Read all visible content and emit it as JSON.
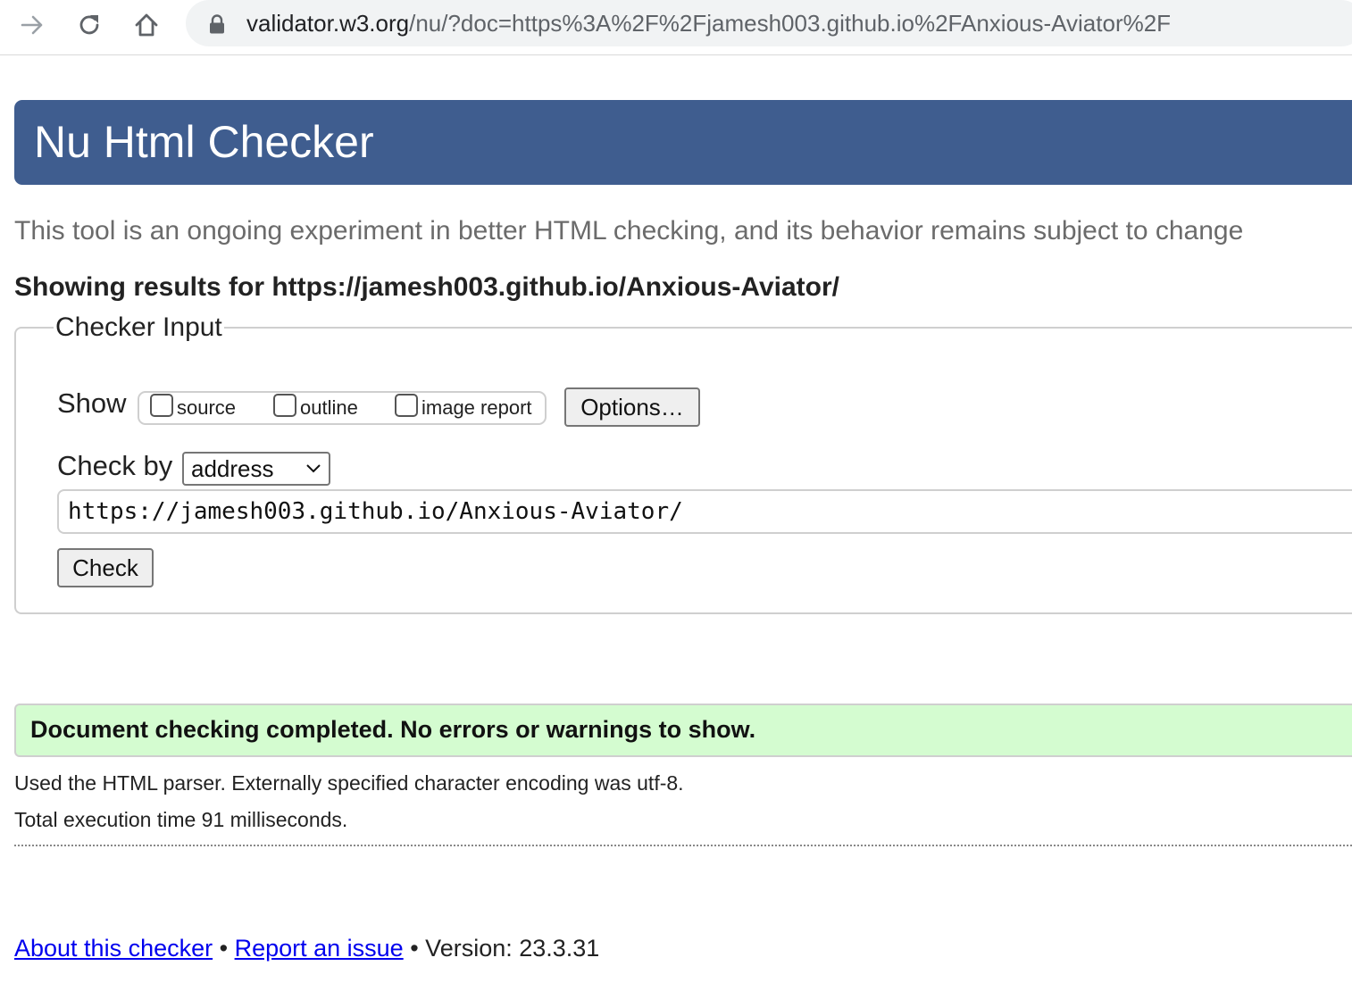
{
  "browser": {
    "url_host": "validator.w3.org",
    "url_rest": "/nu/?doc=https%3A%2F%2Fjamesh003.github.io%2FAnxious-Aviator%2F"
  },
  "header": {
    "title": "Nu Html Checker"
  },
  "tagline": "This tool is an ongoing experiment in better HTML checking, and its behavior remains subject to change",
  "results_for": "Showing results for https://jamesh003.github.io/Anxious-Aviator/",
  "checker_input": {
    "legend": "Checker Input",
    "show_label": "Show",
    "checkboxes": [
      {
        "label": "source",
        "checked": false
      },
      {
        "label": "outline",
        "checked": false
      },
      {
        "label": "image report",
        "checked": false
      }
    ],
    "options_label": "Options…",
    "check_by_label": "Check by",
    "check_by_value": "address",
    "address_value": "https://jamesh003.github.io/Anxious-Aviator/",
    "check_button_label": "Check"
  },
  "result": {
    "success_message": "Document checking completed. No errors or warnings to show.",
    "parser_info": "Used the HTML parser. Externally specified character encoding was utf-8.",
    "execution_time": "Total execution time 91 milliseconds."
  },
  "footer": {
    "about_link": "About this checker",
    "separator": " • ",
    "report_link": "Report an issue",
    "version_text": "Version: 23.3.31"
  },
  "colors": {
    "header_bg": "#3f5d8f",
    "success_bg": "#d4fcd0",
    "link": "#0000ee"
  },
  "icons": [
    "forward-arrow-icon",
    "reload-icon",
    "home-icon",
    "lock-icon",
    "chevron-down-icon"
  ]
}
